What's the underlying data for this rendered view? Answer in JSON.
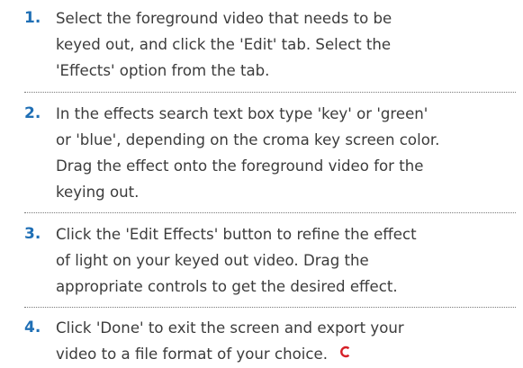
{
  "steps": [
    {
      "number": "1.",
      "lines": [
        "Select the foreground video that needs to be",
        "keyed out, and click the 'Edit' tab. Select the",
        "'Effects' option from the tab."
      ]
    },
    {
      "number": "2.",
      "lines": [
        "In the effects search text box type 'key' or 'green'",
        "or 'blue', depending on the croma key screen color.",
        "Drag the effect onto the foreground video for the",
        "keying out."
      ]
    },
    {
      "number": "3.",
      "lines": [
        "Click the 'Edit Effects' button to refine the effect",
        "of light on your keyed out video. Drag the",
        "appropriate controls to get the desired effect."
      ]
    },
    {
      "number": "4.",
      "lines": [
        "Click 'Done' to exit the screen and export your",
        "video to a file format of your choice."
      ]
    }
  ],
  "end_mark": {
    "icon": "end-of-article-mark-icon",
    "color": "#d62027"
  },
  "colors": {
    "step_number": "#1f6fb5",
    "body_text": "#3c3c3c",
    "divider": "#7a7a7a"
  }
}
